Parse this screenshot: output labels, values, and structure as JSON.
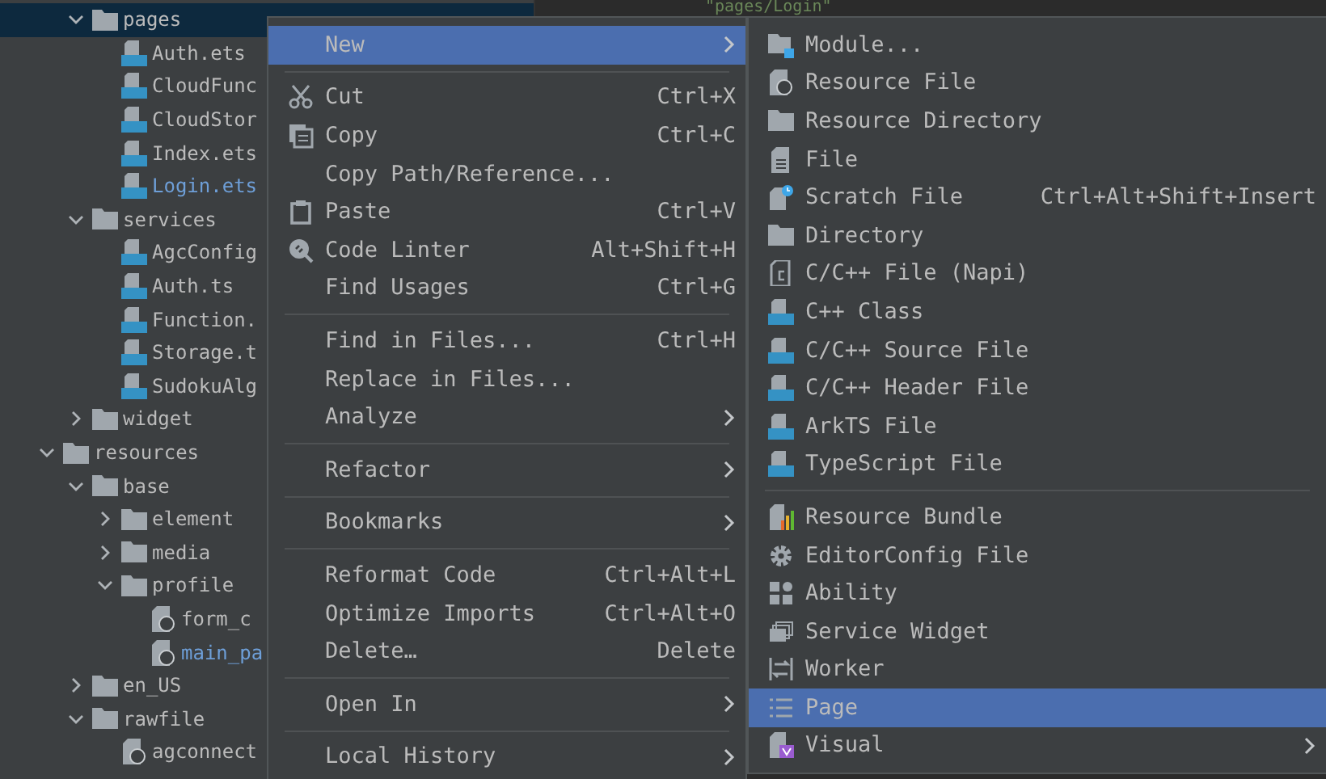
{
  "editor": {
    "line": "\"pages/Login\""
  },
  "tree": [
    {
      "children": [
        {
          "label": "pages",
          "kind": "folder",
          "expanded": true,
          "selected": true,
          "children": [
            {
              "label": "Auth.ets",
              "kind": "ets",
              "modified": false,
              "selected": false
            },
            {
              "label": "CloudFunc",
              "kind": "ets",
              "modified": false,
              "selected": false
            },
            {
              "label": "CloudStor",
              "kind": "ets",
              "modified": false,
              "selected": false
            },
            {
              "label": "Index.ets",
              "kind": "ets",
              "modified": false,
              "selected": false
            },
            {
              "label": "Login.ets",
              "kind": "ets",
              "modified": true,
              "selected": false
            }
          ]
        },
        {
          "label": "services",
          "kind": "folder",
          "expanded": true,
          "selected": false,
          "children": [
            {
              "label": "AgcConfig",
              "kind": "ts",
              "modified": false,
              "selected": false
            },
            {
              "label": "Auth.ts",
              "kind": "ts",
              "modified": false,
              "selected": false
            },
            {
              "label": "Function.",
              "kind": "ts",
              "modified": false,
              "selected": false
            },
            {
              "label": "Storage.t",
              "kind": "ts",
              "modified": false,
              "selected": false
            },
            {
              "label": "SudokuAlg",
              "kind": "ts",
              "modified": false,
              "selected": false
            }
          ]
        },
        {
          "label": "widget",
          "kind": "folder",
          "expanded": false,
          "selected": false
        }
      ]
    },
    {
      "label": "resources",
      "kind": "folder",
      "expanded": true,
      "selected": false,
      "children": [
        {
          "label": "base",
          "kind": "folder",
          "expanded": true,
          "selected": false,
          "children": [
            {
              "label": "element",
              "kind": "folder",
              "expanded": false,
              "selected": false
            },
            {
              "label": "media",
              "kind": "folder",
              "expanded": false,
              "selected": false
            },
            {
              "label": "profile",
              "kind": "folder",
              "expanded": true,
              "selected": false,
              "children": [
                {
                  "label": "form_c",
                  "kind": "json",
                  "modified": false,
                  "selected": false
                },
                {
                  "label": "main_pa",
                  "kind": "json",
                  "modified": true,
                  "selected": false
                }
              ]
            }
          ]
        },
        {
          "label": "en_US",
          "kind": "folder",
          "expanded": false,
          "selected": false
        },
        {
          "label": "rawfile",
          "kind": "folder",
          "expanded": true,
          "selected": false,
          "children": [
            {
              "label": "agconnect",
              "kind": "json",
              "modified": false,
              "selected": false
            }
          ]
        }
      ]
    }
  ],
  "context_menu": [
    {
      "kind": "plain",
      "label": "New",
      "submenu": true,
      "selected": true
    },
    {
      "kind": "separator"
    },
    {
      "kind": "cut",
      "label": "Cut",
      "shortcut": "Ctrl+X",
      "submenu": false,
      "selected": false
    },
    {
      "kind": "copy",
      "label": "Copy",
      "shortcut": "Ctrl+C",
      "submenu": false,
      "selected": false
    },
    {
      "kind": "plain",
      "label": "Copy Path/Reference...",
      "submenu": false,
      "selected": false
    },
    {
      "kind": "paste",
      "label": "Paste",
      "shortcut": "Ctrl+V",
      "submenu": false,
      "selected": false
    },
    {
      "kind": "linter",
      "label": "Code Linter",
      "shortcut": "Alt+Shift+H",
      "submenu": false,
      "selected": false
    },
    {
      "kind": "plain",
      "label": "Find Usages",
      "shortcut": "Ctrl+G",
      "submenu": false,
      "selected": false
    },
    {
      "kind": "separator"
    },
    {
      "kind": "plain",
      "label": "Find in Files...",
      "shortcut": "Ctrl+H",
      "submenu": false,
      "selected": false
    },
    {
      "kind": "plain",
      "label": "Replace in Files...",
      "submenu": false,
      "selected": false
    },
    {
      "kind": "plain",
      "label": "Analyze",
      "submenu": true,
      "selected": false
    },
    {
      "kind": "separator"
    },
    {
      "kind": "plain",
      "label": "Refactor",
      "submenu": true,
      "selected": false
    },
    {
      "kind": "separator"
    },
    {
      "kind": "plain",
      "label": "Bookmarks",
      "submenu": true,
      "selected": false
    },
    {
      "kind": "separator"
    },
    {
      "kind": "plain",
      "label": "Reformat Code",
      "shortcut": "Ctrl+Alt+L",
      "submenu": false,
      "selected": false
    },
    {
      "kind": "plain",
      "label": "Optimize Imports",
      "shortcut": "Ctrl+Alt+O",
      "submenu": false,
      "selected": false
    },
    {
      "kind": "plain",
      "label": "Delete…",
      "shortcut": "Delete",
      "submenu": false,
      "selected": false
    },
    {
      "kind": "separator"
    },
    {
      "kind": "plain",
      "label": "Open In",
      "submenu": true,
      "selected": false
    },
    {
      "kind": "separator"
    },
    {
      "kind": "plain",
      "label": "Local History",
      "submenu": true,
      "selected": false
    }
  ],
  "new_submenu": [
    {
      "kind": "module",
      "label": "Module...",
      "submenu": false,
      "selected": false
    },
    {
      "kind": "resource",
      "label": "Resource File",
      "submenu": false,
      "selected": false
    },
    {
      "kind": "folder",
      "label": "Resource Directory",
      "submenu": false,
      "selected": false
    },
    {
      "kind": "file",
      "label": "File",
      "submenu": false,
      "selected": false
    },
    {
      "kind": "scratch",
      "label": "Scratch File",
      "shortcut": "Ctrl+Alt+Shift+Insert",
      "submenu": false,
      "selected": false
    },
    {
      "kind": "folder",
      "label": "Directory",
      "submenu": false,
      "selected": false
    },
    {
      "kind": "cfile",
      "label": "C/C++ File (Napi)",
      "submenu": false,
      "selected": false
    },
    {
      "kind": "badge",
      "label": "C++ Class",
      "submenu": false,
      "selected": false
    },
    {
      "kind": "badge",
      "label": "C/C++ Source File",
      "submenu": false,
      "selected": false
    },
    {
      "kind": "badge",
      "label": "C/C++ Header File",
      "submenu": false,
      "selected": false
    },
    {
      "kind": "badge",
      "label": "ArkTS File",
      "submenu": false,
      "selected": false
    },
    {
      "kind": "badge",
      "label": "TypeScript File",
      "submenu": false,
      "selected": false
    },
    {
      "kind": "separator"
    },
    {
      "kind": "bundle",
      "label": "Resource Bundle",
      "submenu": false,
      "selected": false
    },
    {
      "kind": "gear",
      "label": "EditorConfig File",
      "submenu": false,
      "selected": false
    },
    {
      "kind": "ability",
      "label": "Ability",
      "submenu": false,
      "selected": false
    },
    {
      "kind": "widget",
      "label": "Service Widget",
      "submenu": false,
      "selected": false
    },
    {
      "kind": "worker",
      "label": "Worker",
      "submenu": false,
      "selected": false
    },
    {
      "kind": "page",
      "label": "Page",
      "submenu": false,
      "selected": true
    },
    {
      "kind": "visual",
      "label": "Visual",
      "submenu": true,
      "selected": false
    }
  ]
}
